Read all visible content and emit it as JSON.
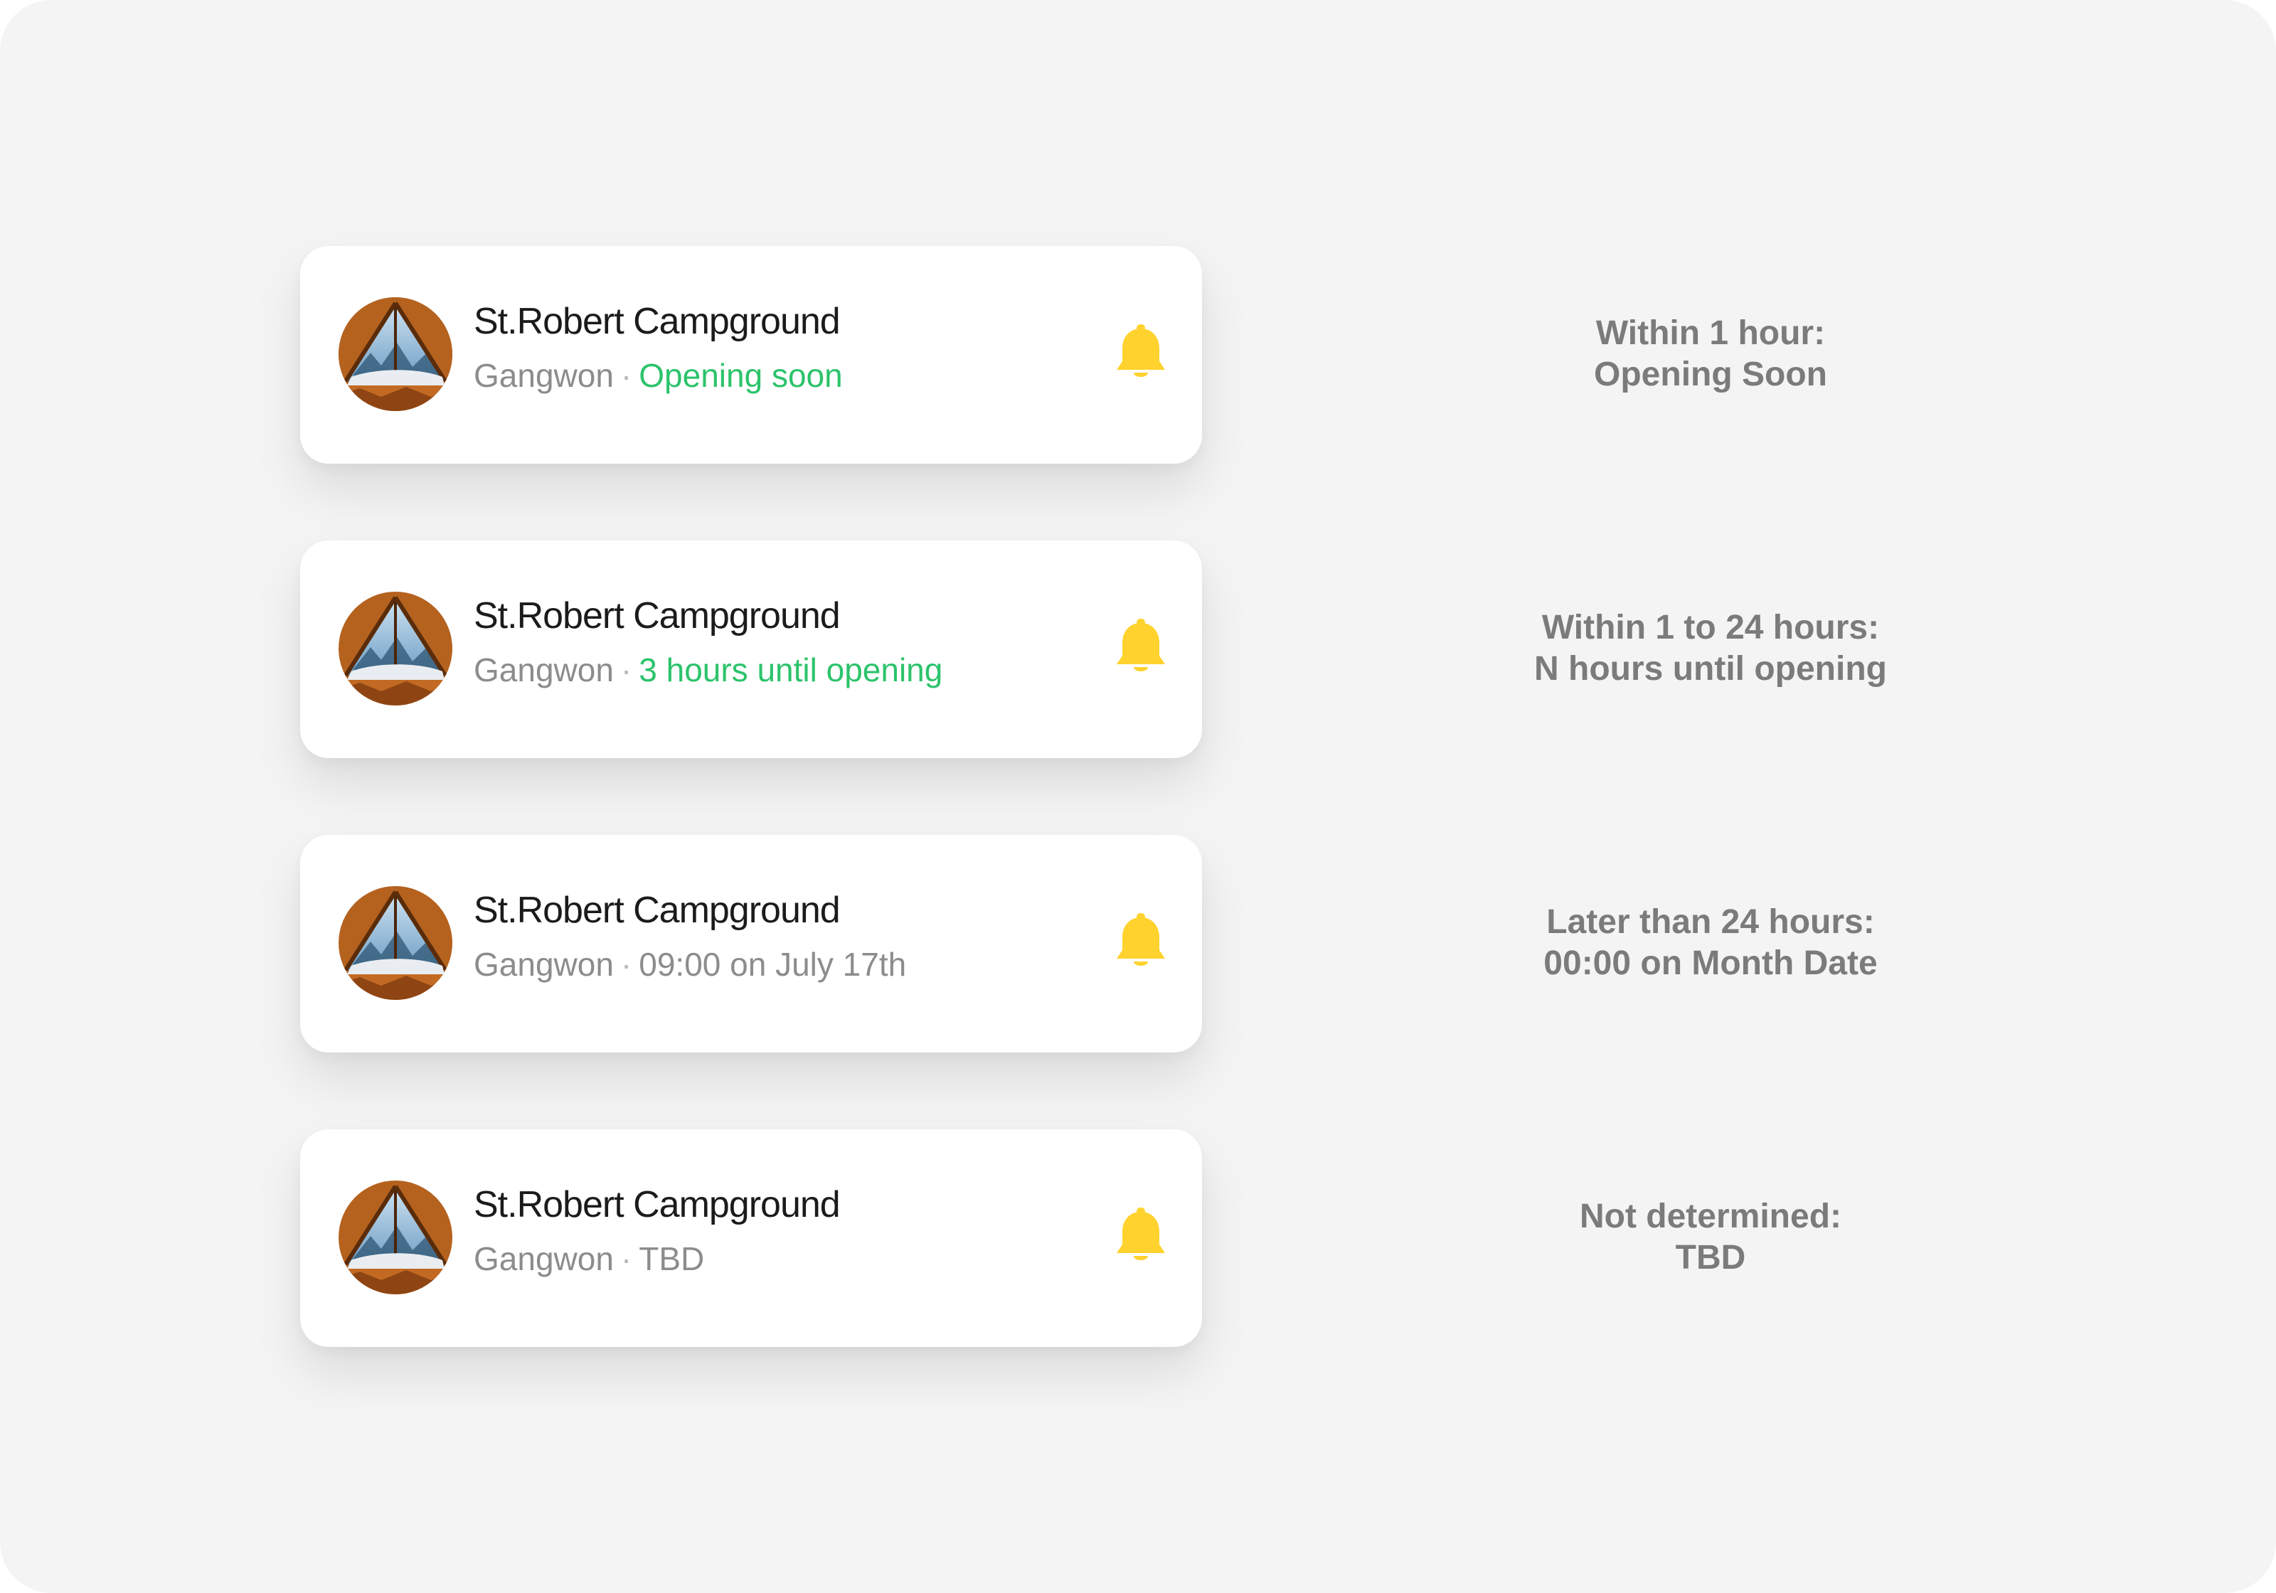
{
  "colors": {
    "background": "#f4f4f4",
    "card": "#ffffff",
    "title_text": "#1b1b1b",
    "meta_text": "#8c8c8c",
    "status_green": "#2cc36b",
    "bell_yellow": "#ffd22e",
    "note_text": "#7b7b7b"
  },
  "cards": [
    {
      "title": "St.Robert Campground",
      "region": "Gangwon",
      "separator": "·",
      "status": "Opening soon",
      "status_color": "green",
      "icon": "bell-icon"
    },
    {
      "title": "St.Robert Campground",
      "region": "Gangwon",
      "separator": "·",
      "status": "3 hours until opening",
      "status_color": "green",
      "icon": "bell-icon"
    },
    {
      "title": "St.Robert Campground",
      "region": "Gangwon",
      "separator": "·",
      "status": "09:00 on July 17th",
      "status_color": "gray",
      "icon": "bell-icon"
    },
    {
      "title": "St.Robert Campground",
      "region": "Gangwon",
      "separator": "·",
      "status": "TBD",
      "status_color": "gray",
      "icon": "bell-icon"
    }
  ],
  "notes": [
    {
      "line1": "Within 1 hour:",
      "line2": "Opening Soon"
    },
    {
      "line1": "Within 1 to 24 hours:",
      "line2": "N hours until opening"
    },
    {
      "line1": "Later than 24 hours:",
      "line2": "00:00 on Month Date"
    },
    {
      "line1": "Not determined:",
      "line2": "TBD"
    }
  ]
}
